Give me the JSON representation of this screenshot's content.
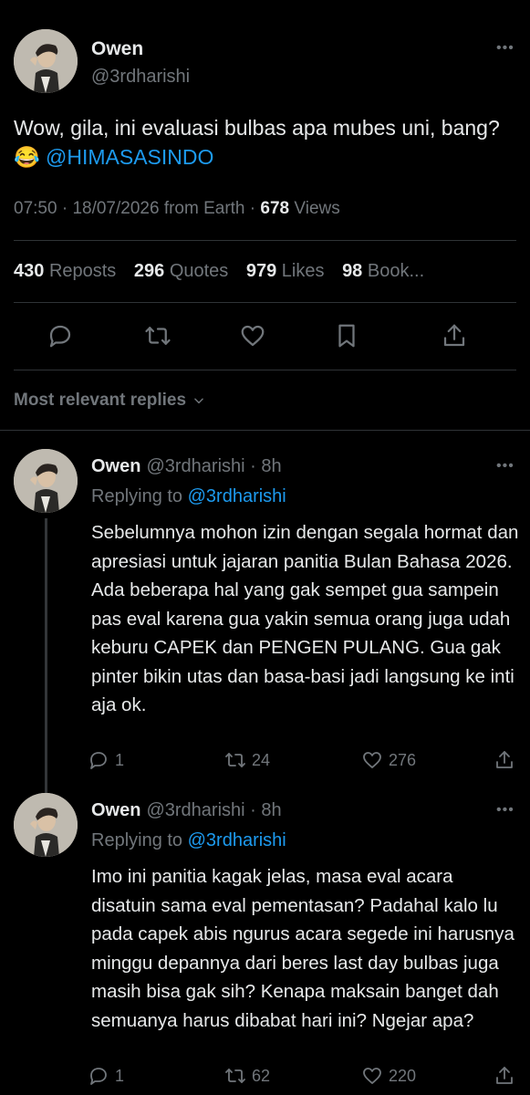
{
  "colors": {
    "background": "#000000",
    "text": "#e7e9ea",
    "muted": "#71767b",
    "link": "#1d9bf0",
    "divider": "#2f3336"
  },
  "main_tweet": {
    "name": "Owen",
    "handle": "@3rdharishi",
    "text": "Wow, gila, ini evaluasi bulbas apa mubes uni, bang?",
    "emoji": "😂",
    "mention": "@HIMASASINDO",
    "time": "07:50",
    "date": "18/07/2026",
    "source": "from Earth",
    "views_count": "678",
    "views_label": "Views",
    "sep": "·",
    "stats": {
      "reposts_count": "430",
      "reposts_label": "Reposts",
      "quotes_count": "296",
      "quotes_label": "Quotes",
      "likes_count": "979",
      "likes_label": "Likes",
      "bookmarks_count": "98",
      "bookmarks_label": "Book..."
    },
    "actions": [
      "reply-icon",
      "repost-icon",
      "like-icon",
      "bookmark-icon",
      "share-icon"
    ]
  },
  "sort_label": "Most relevant replies",
  "replies": [
    {
      "name": "Owen",
      "handle": "@3rdharishi",
      "time": "8h",
      "sep": "·",
      "replying_prefix": "Replying to",
      "replying_to": "@3rdharishi",
      "text": "Sebelumnya mohon izin dengan segala hormat dan apresiasi untuk jajaran panitia Bulan Bahasa 2026. Ada beberapa hal yang gak sempet gua sampein pas eval karena gua yakin semua orang juga udah keburu CAPEK dan PENGEN PULANG. Gua gak pinter bikin utas dan basa-basi jadi langsung ke inti aja ok.",
      "reply_count": "1",
      "repost_count": "24",
      "like_count": "276"
    },
    {
      "name": "Owen",
      "handle": "@3rdharishi",
      "time": "8h",
      "sep": "·",
      "replying_prefix": "Replying to",
      "replying_to": "@3rdharishi",
      "text": "Imo ini panitia kagak jelas, masa eval acara disatuin sama eval pementasan? Padahal kalo lu pada capek abis ngurus acara segede ini harusnya minggu depannya dari beres last day bulbas juga masih bisa gak sih? Kenapa maksain banget dah semuanya harus dibabat hari ini? Ngejar apa?",
      "reply_count": "1",
      "repost_count": "62",
      "like_count": "220"
    }
  ]
}
